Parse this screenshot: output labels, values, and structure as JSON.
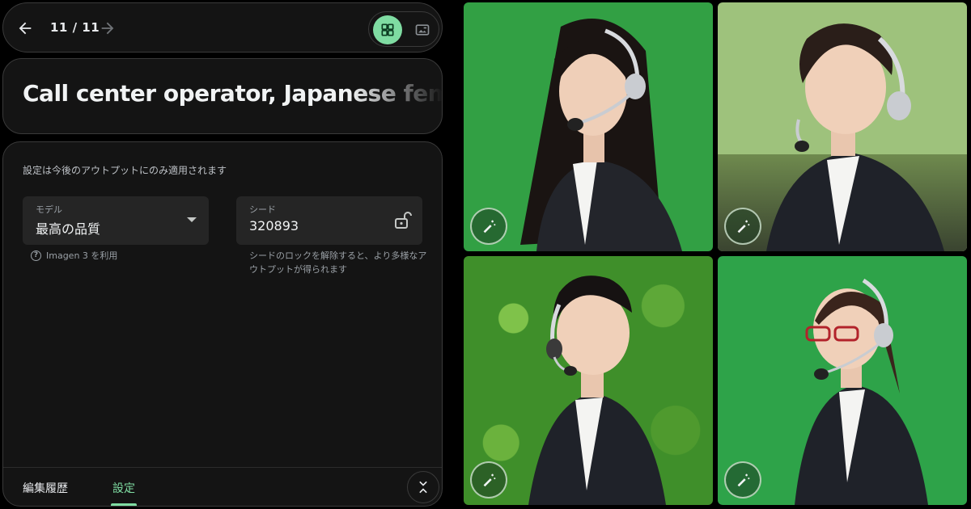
{
  "navigation": {
    "counter": "11 / 11"
  },
  "prompt": {
    "text": "Call center operator, Japanese female"
  },
  "settings": {
    "note": "設定は今後のアウトプットにのみ適用されます",
    "model": {
      "label": "モデル",
      "value": "最高の品質",
      "hint": "Imagen 3 を利用"
    },
    "seed": {
      "label": "シード",
      "value": "320893",
      "hint": "シードのロックを解除すると、より多様なアウトプットが得られます"
    }
  },
  "tabs": [
    {
      "label": "編集履歴",
      "active": false
    },
    {
      "label": "設定",
      "active": true
    }
  ],
  "colors": {
    "accent": "#7fdca2",
    "panel_bg": "#141414",
    "field_bg": "#252525"
  },
  "icons": {
    "back": "arrow-left-icon",
    "forward": "arrow-right-icon",
    "grid_view": "grid-icon",
    "single_view": "image-icon",
    "seed_lock": "unlock-icon",
    "help": "help-icon",
    "collapse": "collapse-icon",
    "edit": "magic-wand-icon"
  }
}
